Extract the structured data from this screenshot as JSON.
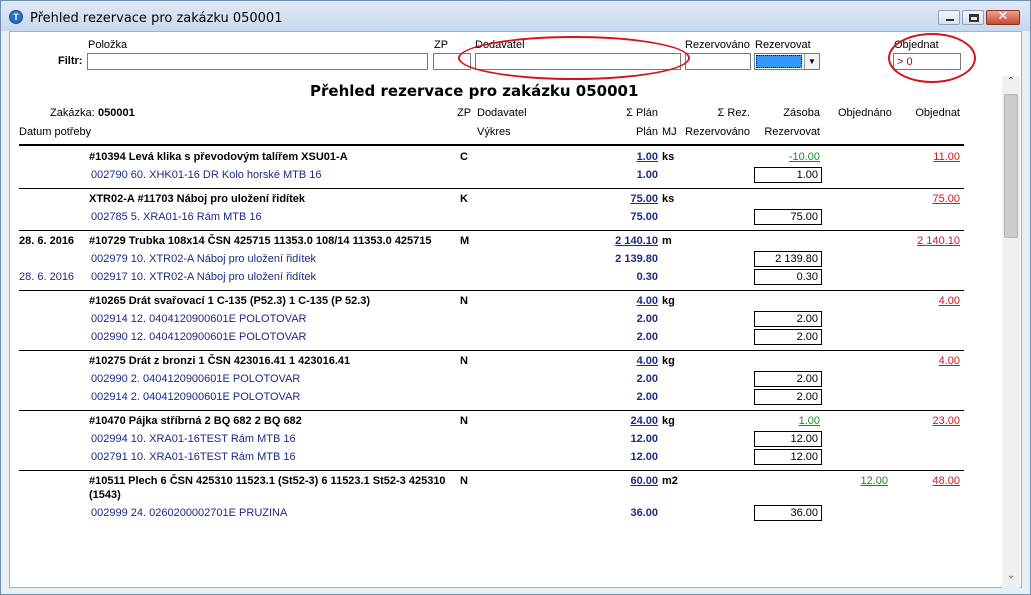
{
  "window": {
    "title": "Přehled rezervace pro zakázku 050001",
    "icon": "app-t-icon",
    "close_glyph": "✕"
  },
  "filter": {
    "label": "Filtr:",
    "col_polozka": "Položka",
    "col_zp": "ZP",
    "col_dodavatel": "Dodavatel",
    "col_rezervovano": "Rezervováno",
    "col_rezervovat": "Rezervovat",
    "col_objednat": "Objednat",
    "polozka_value": "",
    "zp_value": "",
    "dodavatel_value": "",
    "rezervovano_value": "",
    "objednat_value": "> 0",
    "dropdown_arrow": "▼"
  },
  "report": {
    "title": "Přehled rezervace pro zakázku 050001",
    "zakazka_label": "Zakázka:",
    "zakazka_value": "050001",
    "h_zp": "ZP",
    "h_dodavatel": "Dodavatel",
    "h_sigma_plan": "Σ  Plán",
    "h_sigma_rez": "Σ Rez.",
    "h_zasoba": "Zásoba",
    "h_objednano": "Objednáno",
    "h_objednat": "Objednat",
    "h_datum": "Datum potřeby",
    "h_vykres": "Výkres",
    "h_plan": "Plán",
    "h_mj": "MJ",
    "h_rezervovano": "Rezervováno",
    "h_rezervovat": "Rezervovat"
  },
  "rows": [
    {
      "date": "",
      "name": "#10394 Levá klika s převodovým talířem XSU01-A",
      "zp": "C",
      "plan": "1.00",
      "mj": "ks",
      "zasoba": "-10.00",
      "objednano": "",
      "objednat": "11.00",
      "subs": [
        {
          "date": "",
          "text": "002790 60. XHK01-16 DR Kolo horské MTB 16",
          "plan": "1.00",
          "rez": "1.00"
        }
      ]
    },
    {
      "date": "",
      "name": "XTR02-A #11703 Náboj pro uložení řidítek",
      "zp": "K",
      "plan": "75.00",
      "mj": "ks",
      "zasoba": "",
      "objednano": "",
      "objednat": "75.00",
      "subs": [
        {
          "date": "",
          "text": "002785 5. XRA01-16 Rám MTB 16",
          "plan": "75.00",
          "rez": "75.00"
        }
      ]
    },
    {
      "date": "28. 6. 2016",
      "name": "#10729 Trubka 108x14 ČSN 425715 11353.0 108/14 11353.0 425715",
      "zp": "M",
      "plan": "2 140.10",
      "mj": "m",
      "zasoba": "",
      "objednano": "",
      "objednat": "2 140.10",
      "subs": [
        {
          "date": "",
          "text": "002979 10. XTR02-A Náboj pro uložení řidítek",
          "plan": "2 139.80",
          "rez": "2 139.80"
        },
        {
          "date": "28. 6. 2016",
          "text": "002917 10. XTR02-A Náboj pro uložení řidítek",
          "plan": "0.30",
          "rez": "0.30"
        }
      ]
    },
    {
      "date": "",
      "name": "#10265 Drát svařovací 1 C-135 (P52.3) 1 C-135 (P 52.3)",
      "zp": "N",
      "plan": "4.00",
      "mj": "kg",
      "zasoba": "",
      "objednano": "",
      "objednat": "4.00",
      "subs": [
        {
          "date": "",
          "text": "002914 12. 0404120900601E POLOTOVAR",
          "plan": "2.00",
          "rez": "2.00"
        },
        {
          "date": "",
          "text": "002990 12. 0404120900601E POLOTOVAR",
          "plan": "2.00",
          "rez": "2.00"
        }
      ]
    },
    {
      "date": "",
      "name": "#10275 Drát z bronzi 1 ČSN 423016.41 1 423016.41",
      "zp": "N",
      "plan": "4.00",
      "mj": "kg",
      "zasoba": "",
      "objednano": "",
      "objednat": "4.00",
      "subs": [
        {
          "date": "",
          "text": "002990 2. 0404120900601E POLOTOVAR",
          "plan": "2.00",
          "rez": "2.00"
        },
        {
          "date": "",
          "text": "002914 2. 0404120900601E POLOTOVAR",
          "plan": "2.00",
          "rez": "2.00"
        }
      ]
    },
    {
      "date": "",
      "name": "#10470 Pájka stříbrná 2 BQ 682 2 BQ 682",
      "zp": "N",
      "plan": "24.00",
      "mj": "kg",
      "zasoba": "1.00",
      "objednano": "",
      "objednat": "23.00",
      "subs": [
        {
          "date": "",
          "text": "002994 10. XRA01-16TEST Rám MTB 16",
          "plan": "12.00",
          "rez": "12.00"
        },
        {
          "date": "",
          "text": "002791 10. XRA01-16TEST Rám MTB 16",
          "plan": "12.00",
          "rez": "12.00"
        }
      ]
    },
    {
      "date": "",
      "name": "#10511 Plech 6 ČSN 425310 11523.1 (St52-3) 6 11523.1 St52-3 425310",
      "name2": "(1543)",
      "zp": "N",
      "plan": "60.00",
      "mj": "m2",
      "zasoba": "",
      "objednano": "12.00",
      "objednat": "48.00",
      "subs": [
        {
          "date": "",
          "text": "002999 24. 0260200002701E PRUZINA",
          "plan": "36.00",
          "rez": "36.00"
        }
      ]
    }
  ],
  "scrollbar": {
    "up_glyph": "⌃",
    "down_glyph": "⌄"
  },
  "colors": {
    "accent_red": "#d3141b",
    "link_blue": "#1a2a8a",
    "green": "#1c8a1c"
  }
}
